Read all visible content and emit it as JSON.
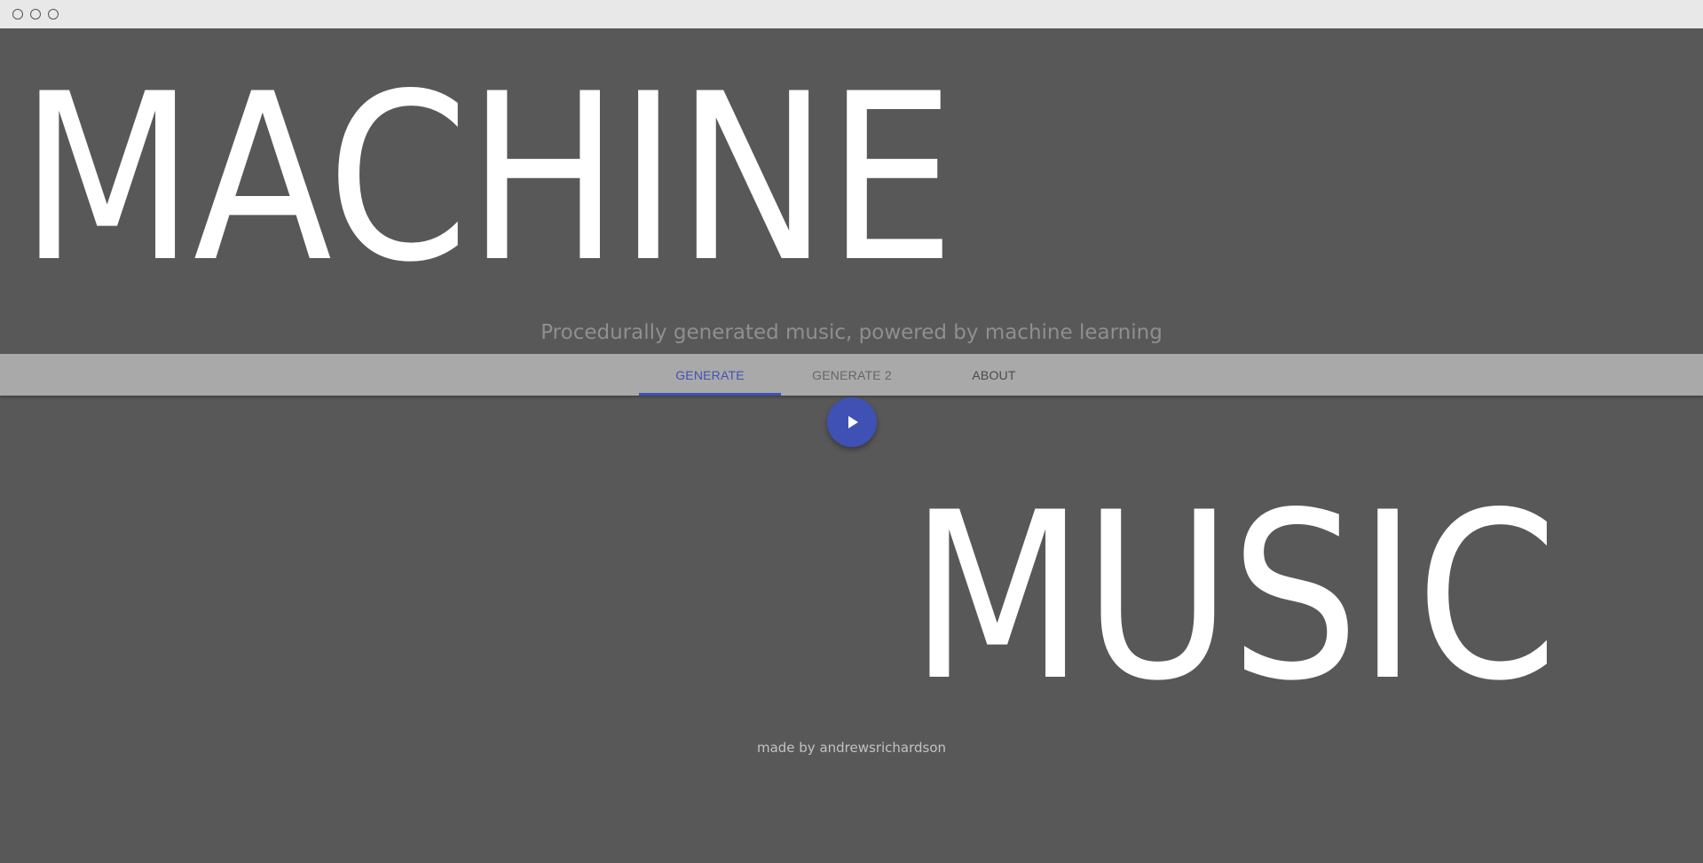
{
  "window": {
    "controls": [
      "close-dot",
      "minimize-dot",
      "maximize-dot"
    ]
  },
  "hero": {
    "title_top": "MACHINE",
    "title_bottom": "MUSIC",
    "tagline": "Procedurally generated music, powered by machine learning"
  },
  "tabs": [
    {
      "label": "GENERATE",
      "active": true
    },
    {
      "label": "GENERATE 2",
      "active": false
    },
    {
      "label": "ABOUT",
      "active": false
    }
  ],
  "player": {
    "icon": "play-icon"
  },
  "footer": {
    "text": "made by andrewsrichardson"
  },
  "colors": {
    "background": "#585858",
    "accent": "#3f51b5",
    "tabbar": "#a9a9a9",
    "title": "#ffffff"
  }
}
